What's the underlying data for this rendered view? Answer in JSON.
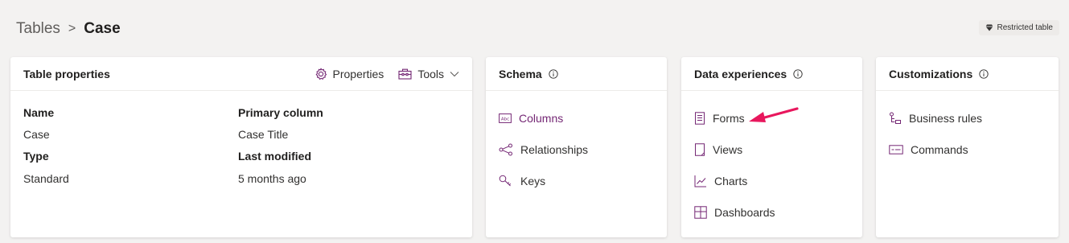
{
  "breadcrumb": {
    "root": "Tables",
    "separator": ">",
    "current": "Case"
  },
  "restricted_badge": {
    "label": "Restricted table",
    "icon": "diamond-icon"
  },
  "table_properties": {
    "title": "Table properties",
    "properties_button": "Properties",
    "tools_button": "Tools",
    "fields": {
      "name_label": "Name",
      "name_value": "Case",
      "type_label": "Type",
      "type_value": "Standard",
      "primary_label": "Primary column",
      "primary_value": "Case Title",
      "modified_label": "Last modified",
      "modified_value": "5 months ago"
    }
  },
  "schema": {
    "title": "Schema",
    "items": [
      {
        "label": "Columns",
        "icon": "columns-icon"
      },
      {
        "label": "Relationships",
        "icon": "relationships-icon"
      },
      {
        "label": "Keys",
        "icon": "keys-icon"
      }
    ]
  },
  "data_experiences": {
    "title": "Data experiences",
    "items": [
      {
        "label": "Forms",
        "icon": "forms-icon"
      },
      {
        "label": "Views",
        "icon": "views-icon"
      },
      {
        "label": "Charts",
        "icon": "charts-icon"
      },
      {
        "label": "Dashboards",
        "icon": "dashboards-icon"
      }
    ]
  },
  "customizations": {
    "title": "Customizations",
    "items": [
      {
        "label": "Business rules",
        "icon": "business-rules-icon"
      },
      {
        "label": "Commands",
        "icon": "commands-icon"
      }
    ]
  },
  "colors": {
    "accent": "#742774",
    "annotation_arrow": "#e8175d",
    "background": "#f3f2f1"
  }
}
